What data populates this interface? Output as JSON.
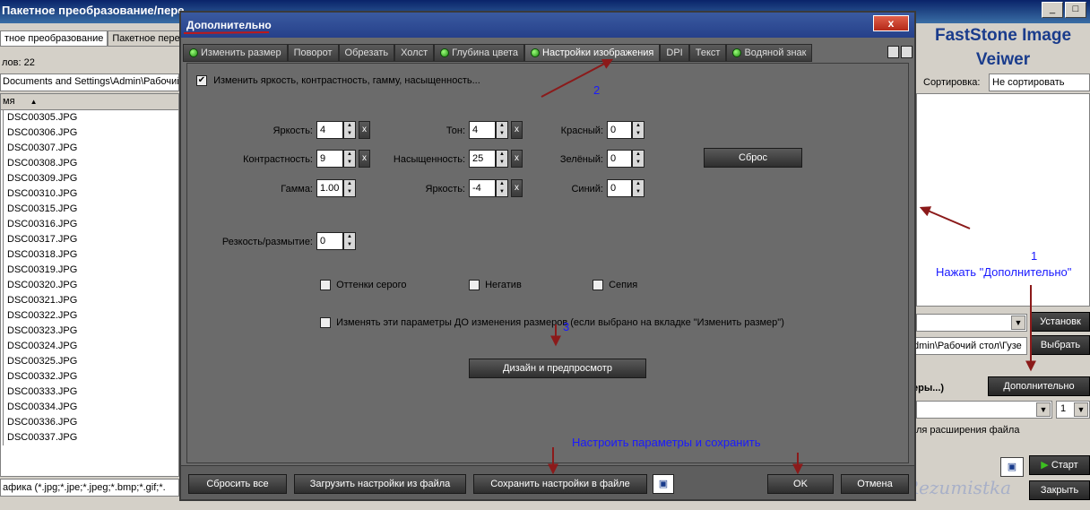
{
  "background": {
    "window_title": "Пакетное преобразование/пере",
    "win_controls": [
      "_",
      "□"
    ],
    "tabs": [
      "тное преобразование",
      "Пакетное пере"
    ],
    "count_text": "лов: 22",
    "path": "Documents and Settings\\Admin\\Рабочий с",
    "list_header": "мя",
    "files": [
      "DSC00305.JPG",
      "DSC00306.JPG",
      "DSC00307.JPG",
      "DSC00308.JPG",
      "DSC00309.JPG",
      "DSC00310.JPG",
      "DSC00315.JPG",
      "DSC00316.JPG",
      "DSC00317.JPG",
      "DSC00318.JPG",
      "DSC00319.JPG",
      "DSC00320.JPG",
      "DSC00321.JPG",
      "DSC00322.JPG",
      "DSC00323.JPG",
      "DSC00324.JPG",
      "DSC00325.JPG",
      "DSC00332.JPG",
      "DSC00333.JPG",
      "DSC00334.JPG",
      "DSC00336.JPG",
      "DSC00337.JPG"
    ],
    "filter_text": "афика (*.jpg;*.jpe;*.jpeg;*.bmp;*.gif;*.",
    "app_name_line1": "FastStone Image",
    "app_name_line2": "Veiwer",
    "sort_label": "Сортировка:",
    "sort_value": "Не сортировать",
    "install_button": "Установк",
    "folder_path": "dmin\\Рабочий стол\\Гузе",
    "choose_button": "Выбрать",
    "params_label": "еры...)",
    "advanced_button": "Дополнительно",
    "count_value": "1",
    "ext_label": "ля расширения файла",
    "start_button": "Старт",
    "close_button": "Закрыть",
    "watermark": "Rezumistka"
  },
  "dialog": {
    "title": "Дополнительно",
    "close_glyph": "x",
    "tabs": [
      {
        "label": "Изменить размер",
        "led": true
      },
      {
        "label": "Поворот",
        "led": false
      },
      {
        "label": "Обрезать",
        "led": false
      },
      {
        "label": "Холст",
        "led": false
      },
      {
        "label": "Глубина цвета",
        "led": true
      },
      {
        "label": "Настройки изображения",
        "led": true
      },
      {
        "label": "DPI",
        "led": false
      },
      {
        "label": "Текст",
        "led": false
      },
      {
        "label": "Водяной знак",
        "led": true
      }
    ],
    "active_tab": "Настройки изображения",
    "enable_label": "Изменить яркость, контрастность, гамму, насыщенность...",
    "enable_checked": true,
    "brightness_label": "Яркость:",
    "brightness_value": "4",
    "contrast_label": "Контрастность:",
    "contrast_value": "9",
    "gamma_label": "Гамма:",
    "gamma_value": "1.00",
    "hue_label": "Тон:",
    "hue_value": "4",
    "saturation_label": "Насыщенность:",
    "saturation_value": "25",
    "lightness_label": "Яркость:",
    "lightness_value": "-4",
    "red_label": "Красный:",
    "red_value": "0",
    "green_label": "Зелёный:",
    "green_value": "0",
    "blue_label": "Синий:",
    "blue_value": "0",
    "reset_button": "Сброс",
    "x_glyph": "x",
    "sharpness_label": "Резкость/размытие:",
    "sharpness_value": "0",
    "grayscale_label": "Оттенки серого",
    "negative_label": "Негатив",
    "sepia_label": "Сепия",
    "before_resize_label": "Изменять эти параметры ДО изменения размеров (если выбрано на вкладке \"Изменить размер\")",
    "design_button": "Дизайн и предпросмотр",
    "reset_all_button": "Сбросить все",
    "load_button": "Загрузить настройки из файла",
    "save_button": "Сохранить настройки в файле",
    "ok_button": "OK",
    "cancel_button": "Отмена"
  },
  "annotations": {
    "step1_number": "1",
    "step1_text": "Нажать \"Дополнительно\"",
    "step2_number": "2",
    "step3_number": "3",
    "step4_text": "Настроить параметры и сохранить",
    "arrow_color": "#8b1a1a"
  },
  "colors": {
    "dialog_bg": "#6b6b6b",
    "title_bar": "#26408a",
    "led_green": "#3cc020",
    "annotation_blue": "#1a1aff"
  }
}
